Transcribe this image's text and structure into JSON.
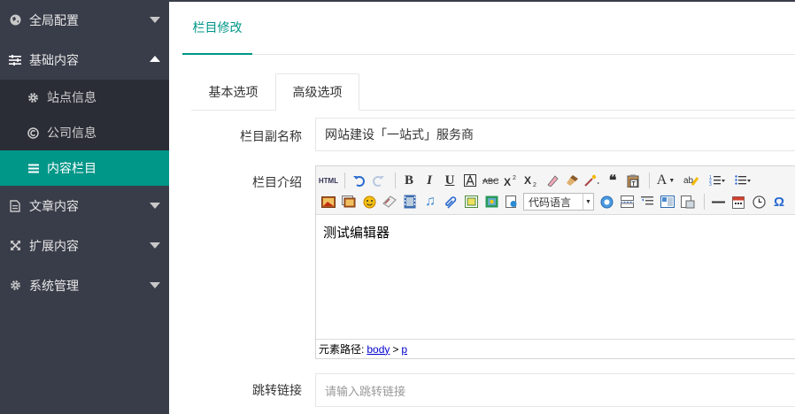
{
  "sidebar": {
    "groups": [
      {
        "label": "全局配置",
        "icon": "globe-icon",
        "expanded": false
      },
      {
        "label": "基础内容",
        "icon": "sliders-icon",
        "expanded": true,
        "items": [
          {
            "label": "站点信息",
            "icon": "gear-icon"
          },
          {
            "label": "公司信息",
            "icon": "copyright-icon"
          },
          {
            "label": "内容栏目",
            "icon": "list-icon",
            "active": true
          }
        ]
      },
      {
        "label": "文章内容",
        "icon": "document-icon",
        "expanded": false
      },
      {
        "label": "扩展内容",
        "icon": "expand-icon",
        "expanded": false
      },
      {
        "label": "系统管理",
        "icon": "cog-icon",
        "expanded": false
      }
    ]
  },
  "header": {
    "title_tab": "栏目修改"
  },
  "tabs": [
    {
      "label": "基本选项",
      "active": false
    },
    {
      "label": "高级选项",
      "active": true
    }
  ],
  "form": {
    "subname_label": "栏目副名称",
    "subname_value": "网站建设「一站式」服务商",
    "intro_label": "栏目介绍",
    "redirect_label": "跳转链接",
    "redirect_placeholder": "请输入跳转链接"
  },
  "editor": {
    "code_language_select": "代码语言",
    "content": "测试编辑器",
    "status_prefix": "元素路径:",
    "path": [
      "body",
      "p"
    ],
    "path_sep": ">",
    "toolbar_html_label": "HTML"
  },
  "colors": {
    "sidebar_bg": "#393d49",
    "submenu_bg": "#2a2d36",
    "accent": "#009688"
  }
}
